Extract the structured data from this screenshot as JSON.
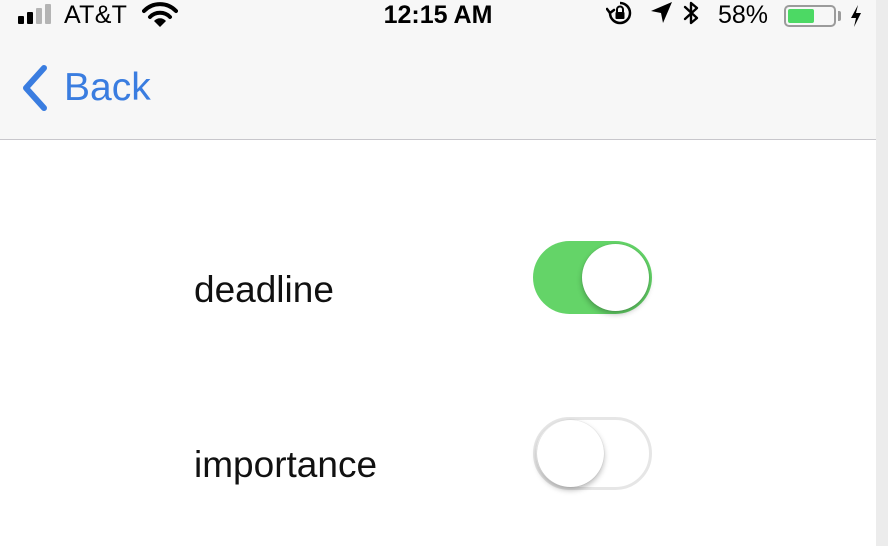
{
  "status_bar": {
    "carrier": "AT&T",
    "time": "12:15 AM",
    "battery_percent": "58%",
    "battery_level": 0.58,
    "signal_bars_filled": 2,
    "signal_bars_total": 4,
    "icons": [
      "cellular-signal-icon",
      "wifi-icon",
      "orientation-lock-icon",
      "location-arrow-icon",
      "bluetooth-icon",
      "battery-icon",
      "charging-bolt-icon"
    ]
  },
  "nav": {
    "back_label": "Back",
    "back_icon": "chevron-left-icon"
  },
  "settings": [
    {
      "label": "deadline",
      "enabled": true
    },
    {
      "label": "importance",
      "enabled": false
    }
  ],
  "colors": {
    "accent": "#3a7de0",
    "switch_on": "#64d468",
    "battery": "#4cd964"
  }
}
